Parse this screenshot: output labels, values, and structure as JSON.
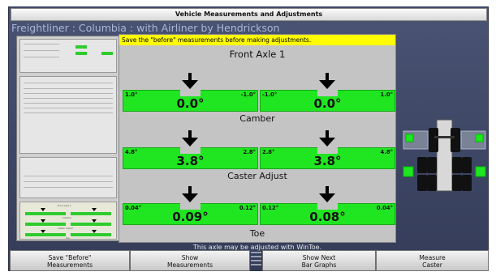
{
  "window": {
    "title": "Vehicle Measurements and Adjustments"
  },
  "vehicle": "Freightliner : Columbia : with Airliner by Hendrickson",
  "panel": {
    "banner": "Save the \"before\" measurements before making adjustments.",
    "axle_title": "Front Axle 1",
    "sections": [
      {
        "label": "Camber",
        "gauges": [
          {
            "side": "left",
            "low": "1.0°",
            "high": "-1.0°",
            "value": "0.0°"
          },
          {
            "side": "right",
            "low": "-1.0°",
            "high": "1.0°",
            "value": "0.0°"
          }
        ]
      },
      {
        "label": "Caster Adjust",
        "gauges": [
          {
            "side": "left",
            "low": "4.8°",
            "high": "2.8°",
            "value": "3.8°"
          },
          {
            "side": "right",
            "low": "2.8°",
            "high": "4.8°",
            "value": "3.8°"
          }
        ]
      },
      {
        "label": "Toe",
        "gauges": [
          {
            "side": "left",
            "low": "0.04°",
            "high": "0.12°",
            "value": "0.09°"
          },
          {
            "side": "right",
            "low": "0.12°",
            "high": "0.04°",
            "value": "0.08°"
          }
        ]
      }
    ]
  },
  "note": "This axle may be adjusted with WinToe.",
  "buttons": [
    {
      "line1": "Save \"Before\"",
      "line2": "Measurements"
    },
    {
      "line1": "Show",
      "line2": "Measurements"
    },
    {
      "line1": "Show Next",
      "line2": "Bar Graphs"
    },
    {
      "line1": "Measure",
      "line2": "Caster"
    }
  ],
  "thumbnail": {
    "axle_title": "Front Axle 1",
    "labels": [
      "Camber",
      "Caster Adjust",
      "Toe"
    ]
  },
  "colors": {
    "gauge_green": "#1fe620",
    "banner_yellow": "#fffb00",
    "background": "#3c4563"
  },
  "icons": [
    "down-arrow-icon",
    "vehicle-chassis-icon",
    "wheel-sensor-icon"
  ]
}
